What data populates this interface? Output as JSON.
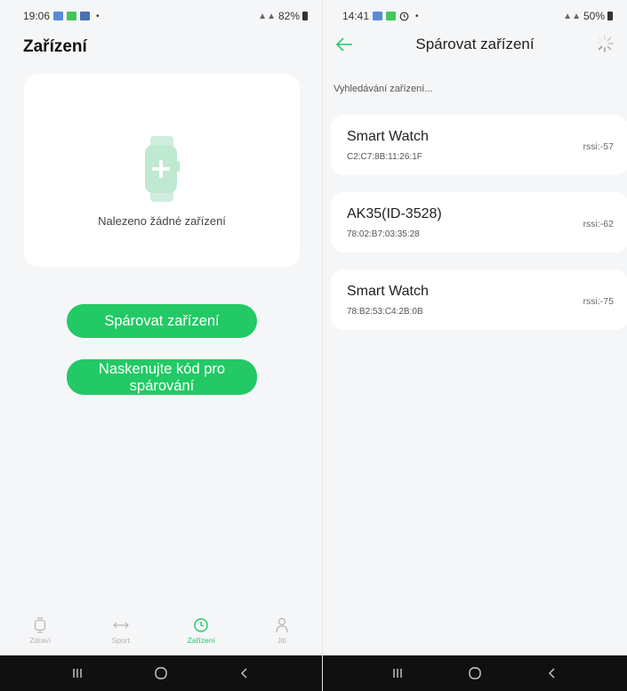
{
  "left_screen": {
    "status_bar": {
      "time": "19:06",
      "dot": "•",
      "battery": "82%"
    },
    "title": "Zařízení",
    "empty_state": {
      "text": "Nalezeno žádné zařízení"
    },
    "buttons": {
      "pair": "Spárovat zařízení",
      "scan_code": "Naskenujte kód pro spárování"
    },
    "bottom_nav": [
      {
        "label": "Zdraví",
        "icon": "watch-outline-icon"
      },
      {
        "label": "Sport",
        "icon": "arrows-horizontal-icon"
      },
      {
        "label": "Zařízení",
        "icon": "device-clock-icon"
      },
      {
        "label": "Jiti",
        "icon": "person-icon"
      }
    ]
  },
  "right_screen": {
    "status_bar": {
      "time": "14:41",
      "dot": "•",
      "battery": "50%"
    },
    "title": "Spárovat zařízení",
    "search_status": "Vyhledávání zařízení...",
    "devices": [
      {
        "name": "Smart Watch",
        "mac": "C2:C7:8B:11:26:1F",
        "rssi": "rssi:-57"
      },
      {
        "name": "AK35(ID-3528)",
        "mac": "78:02:B7:03:35:28",
        "rssi": "rssi:-62"
      },
      {
        "name": "Smart Watch",
        "mac": "78:B2:53:C4:2B:0B",
        "rssi": "rssi:-75"
      }
    ]
  },
  "colors": {
    "accent": "#22c965",
    "background": "#f5f6f8",
    "card": "#ffffff",
    "system_nav": "#101010"
  }
}
